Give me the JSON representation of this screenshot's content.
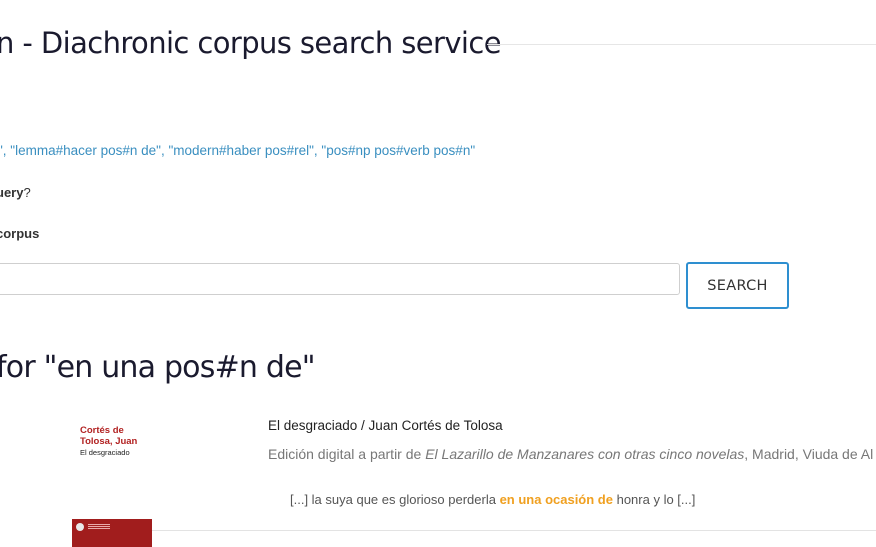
{
  "header": {
    "title": "n - Diachronic corpus search service"
  },
  "examples": [
    "\", ",
    "\"lemma#hacer pos#n de\"",
    ", ",
    "\"modern#haber pos#rel\"",
    ", ",
    "\"pos#np pos#verb pos#n\""
  ],
  "help": {
    "bold": "uery",
    "rest": "?"
  },
  "corpus_label": "corpus",
  "search": {
    "value": "",
    "placeholder": "",
    "button_label": "SEARCH"
  },
  "results": {
    "heading": "for \"en una pos#n de\"",
    "items": [
      {
        "cover_author_line1": "Cortés de",
        "cover_author_line2": "Tolosa, Juan",
        "cover_title": "El desgraciado",
        "title": "El desgraciado / Juan Cortés de Tolosa",
        "source_prefix": "Edición digital a partir de ",
        "source_book": "El Lazarillo de Manzanares con otras cinco novelas",
        "source_suffix": ", Madrid, Viuda de Al",
        "kwic_left": "[...] la suya que es glorioso perderla ",
        "kwic_hit": "en una ocasión de",
        "kwic_right": " honra y lo [...]"
      }
    ]
  },
  "colors": {
    "accent": "#2e8fd0",
    "link": "#3a8fc0",
    "hit": "#f0a020",
    "cover_red": "#b22222"
  }
}
